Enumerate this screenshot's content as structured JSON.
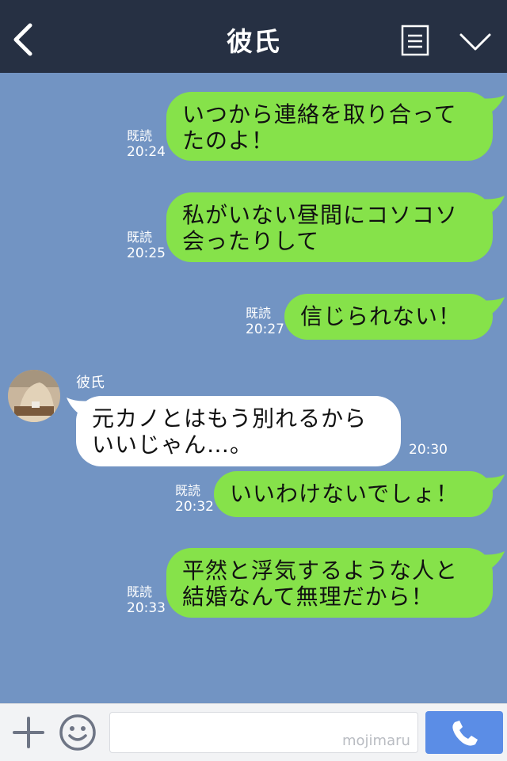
{
  "header": {
    "title": "彼氏",
    "icons": {
      "back": "chevron-left-icon",
      "notes": "notes-icon",
      "menu": "chevron-down-icon"
    }
  },
  "colors": {
    "header_bg": "#263043",
    "chat_bg": "#7294c3",
    "my_bubble": "#86e24a",
    "their_bubble": "#ffffff",
    "call_button": "#5b8de6"
  },
  "messages": [
    {
      "from": "me",
      "lines": [
        "いつから連絡を取り合って",
        "たのよ！"
      ],
      "read": "既読",
      "time": "20:24"
    },
    {
      "from": "me",
      "lines": [
        "私がいない昼間にコソコソ",
        "会ったりして"
      ],
      "read": "既読",
      "time": "20:25"
    },
    {
      "from": "me",
      "lines": [
        "信じられない！"
      ],
      "read": "既読",
      "time": "20:27"
    },
    {
      "from": "them",
      "sender": "彼氏",
      "lines": [
        "元カノとはもう別れるから",
        "いいじゃん…。"
      ],
      "time": "20:30"
    },
    {
      "from": "me",
      "lines": [
        "いいわけないでしょ！"
      ],
      "read": "既読",
      "time": "20:32"
    },
    {
      "from": "me",
      "lines": [
        "平然と浮気するような人と",
        "結婚なんて無理だから！"
      ],
      "read": "既読",
      "time": "20:33"
    }
  ],
  "input": {
    "placeholder": "",
    "watermark": "mojimaru",
    "icons": {
      "plus": "plus-icon",
      "emoji": "emoji-icon",
      "call": "phone-icon"
    }
  }
}
